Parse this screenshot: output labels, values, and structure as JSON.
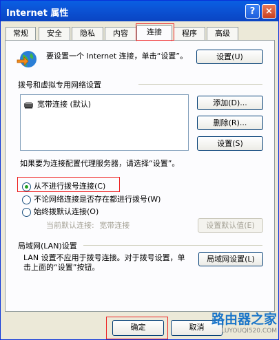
{
  "window": {
    "title": "Internet 属性",
    "help_label": "?",
    "close_label": "×"
  },
  "tabs": [
    {
      "label": "常规"
    },
    {
      "label": "安全"
    },
    {
      "label": "隐私"
    },
    {
      "label": "内容"
    },
    {
      "label": "连接",
      "active": true
    },
    {
      "label": "程序"
    },
    {
      "label": "高级"
    }
  ],
  "setup": {
    "description": "要设置一个 Internet 连接，单击“设置”。",
    "button": "设置(U)"
  },
  "dialup": {
    "section_label": "拨号和虚拟专用网络设置",
    "items": [
      {
        "label": "宽带连接 (默认)",
        "icon": "broadband-connection-icon"
      }
    ],
    "add_button": "添加(D)...",
    "remove_button": "删除(R)...",
    "settings_button": "设置(S)"
  },
  "proxy_note": "如果要为连接配置代理服务器，请选择“设置”。",
  "dial_options": [
    {
      "label": "从不进行拨号连接(C)",
      "selected": true
    },
    {
      "label": "不论网络连接是否存在都进行拨号(W)",
      "selected": false
    },
    {
      "label": "始终拨默认连接(O)",
      "selected": false
    }
  ],
  "current_default": {
    "label": "当前默认连接:",
    "value": "宽带连接"
  },
  "set_default_button": "设置默认值(E)",
  "lan": {
    "section_label": "局域网(LAN)设置",
    "description": "LAN 设置不应用于拨号连接。对于拨号设置，单击上面的“设置”按钮。",
    "button": "局域网设置(L)"
  },
  "footer": {
    "ok": "确定",
    "cancel": "取消"
  },
  "watermark": {
    "main": "路由器之家",
    "sub": "LUYOUQI520.COM"
  },
  "colors": {
    "highlight": "#e22222",
    "title_bar": "#0a5fe3",
    "watermark": "#1a75c9"
  }
}
